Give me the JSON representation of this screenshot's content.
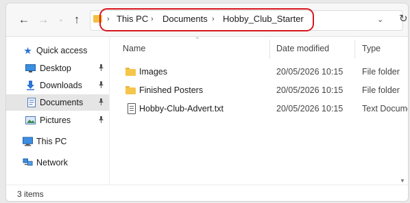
{
  "toolbar": {
    "back_glyph": "←",
    "forward_glyph": "→",
    "recent_glyph": "⌄",
    "up_glyph": "↑",
    "separator_glyph": "›",
    "breadcrumb": [
      "This PC",
      "Documents",
      "Hobby_Club_Starter"
    ],
    "dropdown_glyph": "⌄",
    "refresh_glyph": "↻"
  },
  "sidebar": {
    "items": [
      {
        "label": "Quick access",
        "icon": "star-icon",
        "pinned": false
      },
      {
        "label": "Desktop",
        "icon": "desktop-icon",
        "pinned": true
      },
      {
        "label": "Downloads",
        "icon": "download-icon",
        "pinned": true
      },
      {
        "label": "Documents",
        "icon": "documents-icon",
        "pinned": true,
        "selected": true
      },
      {
        "label": "Pictures",
        "icon": "pictures-icon",
        "pinned": true
      },
      {
        "label": "This PC",
        "icon": "computer-icon",
        "pinned": false
      },
      {
        "label": "Network",
        "icon": "network-icon",
        "pinned": false
      }
    ],
    "pin_glyph": "📌"
  },
  "columns": {
    "name": "Name",
    "date": "Date modified",
    "type": "Type",
    "sort_glyph": "⌃"
  },
  "files": [
    {
      "name": "Images",
      "date": "20/05/2026 10:15",
      "type": "File folder",
      "icon": "folder-icon"
    },
    {
      "name": "Finished Posters",
      "date": "20/05/2026 10:15",
      "type": "File folder",
      "icon": "folder-icon"
    },
    {
      "name": "Hobby-Club-Advert.txt",
      "date": "20/05/2026 10:15",
      "type": "Text Documen",
      "icon": "text-file-icon"
    }
  ],
  "status": {
    "item_count": "3 items"
  },
  "colors": {
    "folder": "#f5c64b",
    "highlight": "#d7151c",
    "selected_bg": "#e5e5e5",
    "star": "#2b73d6"
  }
}
